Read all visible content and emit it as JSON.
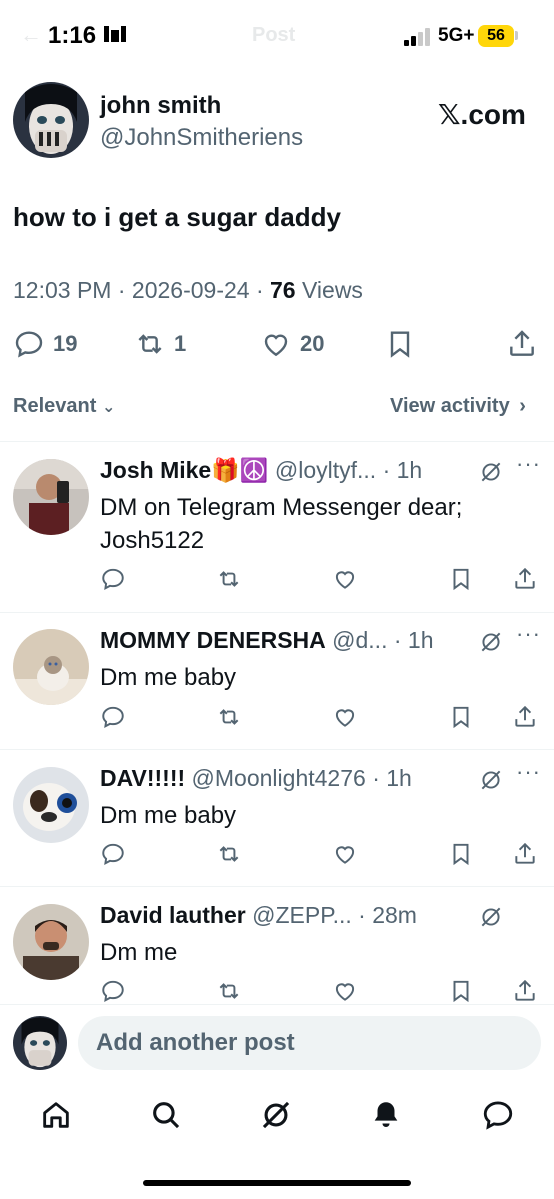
{
  "status_bar": {
    "time": "1:16",
    "time_extra": "",
    "title": "Post",
    "network": "5G+",
    "battery": "56"
  },
  "post": {
    "author_name": "john smith",
    "author_handle": "@JohnSmitheriens",
    "brand": "𝕏.com",
    "text": "how to i get a sugar daddy",
    "time": "12:03 PM",
    "date": "2026-09-24",
    "views_count": "76",
    "views_label": "Views",
    "replies": "19",
    "reposts": "1",
    "likes": "20"
  },
  "filters": {
    "sort": "Relevant",
    "view_activity": "View activity"
  },
  "replies": [
    {
      "name": "Josh Mike🎁☮️",
      "handle": "@loyltyf...",
      "time": "1h",
      "text": "DM on Telegram Messenger dear; Josh5122"
    },
    {
      "name": "MOMMY DENERSHA",
      "handle": "@d...",
      "time": "1h",
      "text": "Dm me baby"
    },
    {
      "name": "DAV!!!!!",
      "handle": "@Moonlight4276",
      "time": "1h",
      "text": "Dm me baby"
    },
    {
      "name": "David lauther",
      "handle": "@ZEPP...",
      "time": "28m",
      "text": "Dm me"
    }
  ],
  "compose": {
    "placeholder": "Add another post"
  },
  "nav": [
    "home-icon",
    "search-icon",
    "grok-icon",
    "notifications-icon",
    "messages-icon"
  ],
  "colors": {
    "text": "#0f1419",
    "secondary": "#536471",
    "divider": "#eff3f4",
    "battery": "#ffd60a"
  }
}
